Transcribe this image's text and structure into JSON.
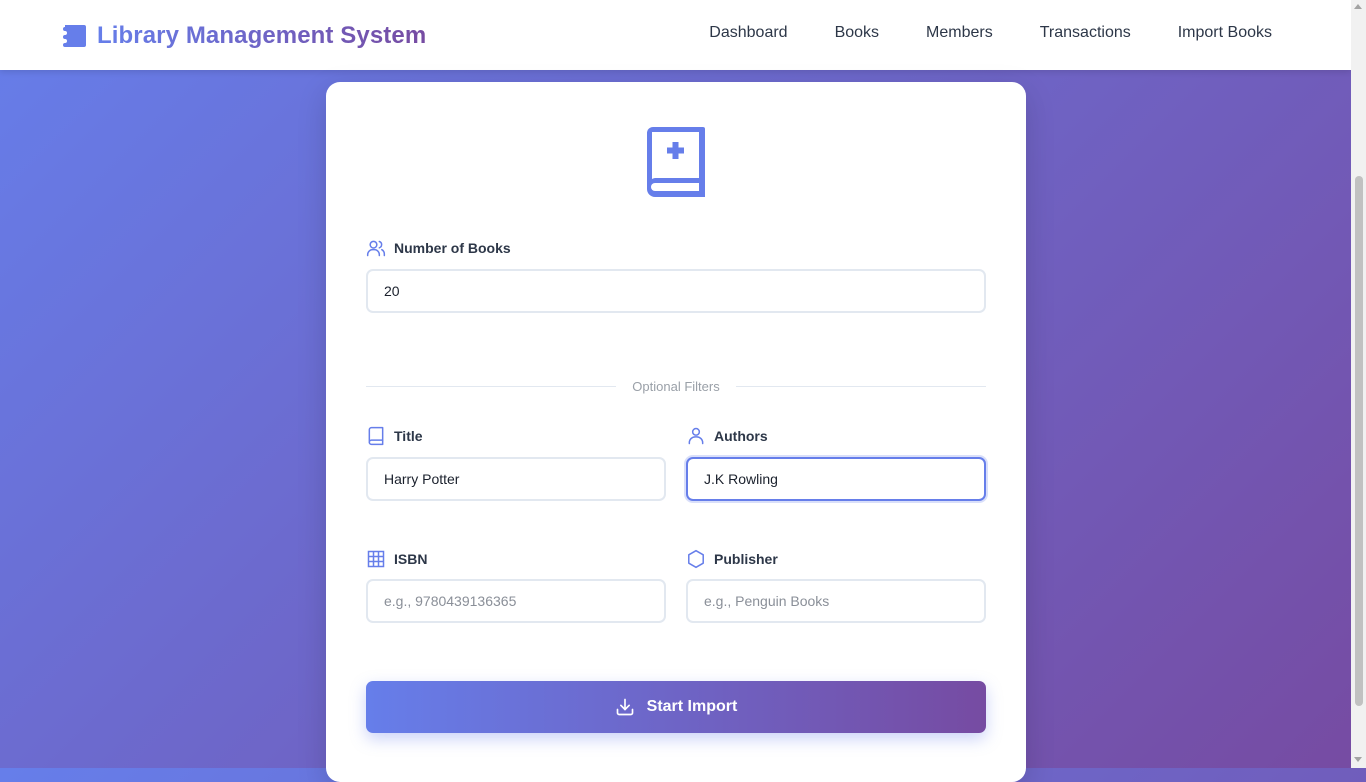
{
  "header": {
    "brand_title": "Library Management System",
    "brand_icon": "book-icon",
    "nav": [
      "Dashboard",
      "Books",
      "Members",
      "Transactions",
      "Import Books"
    ]
  },
  "form": {
    "hero_icon": "book-plus-icon",
    "number_of_books": {
      "label": "Number of Books",
      "value": "20",
      "icon": "users-icon"
    },
    "divider_text": "Optional Filters",
    "title": {
      "label": "Title",
      "value": "Harry Potter",
      "icon": "book-outline-icon"
    },
    "authors": {
      "label": "Authors",
      "value": "J.K Rowling",
      "icon": "user-icon"
    },
    "isbn": {
      "label": "ISBN",
      "placeholder": "e.g., 9780439136365",
      "icon": "grid-icon"
    },
    "publisher": {
      "label": "Publisher",
      "placeholder": "e.g., Penguin Books",
      "icon": "hexagon-icon"
    },
    "submit_label": "Start Import",
    "submit_icon": "download-icon"
  },
  "colors": {
    "accent_start": "#667eea",
    "accent_end": "#764ba2"
  }
}
